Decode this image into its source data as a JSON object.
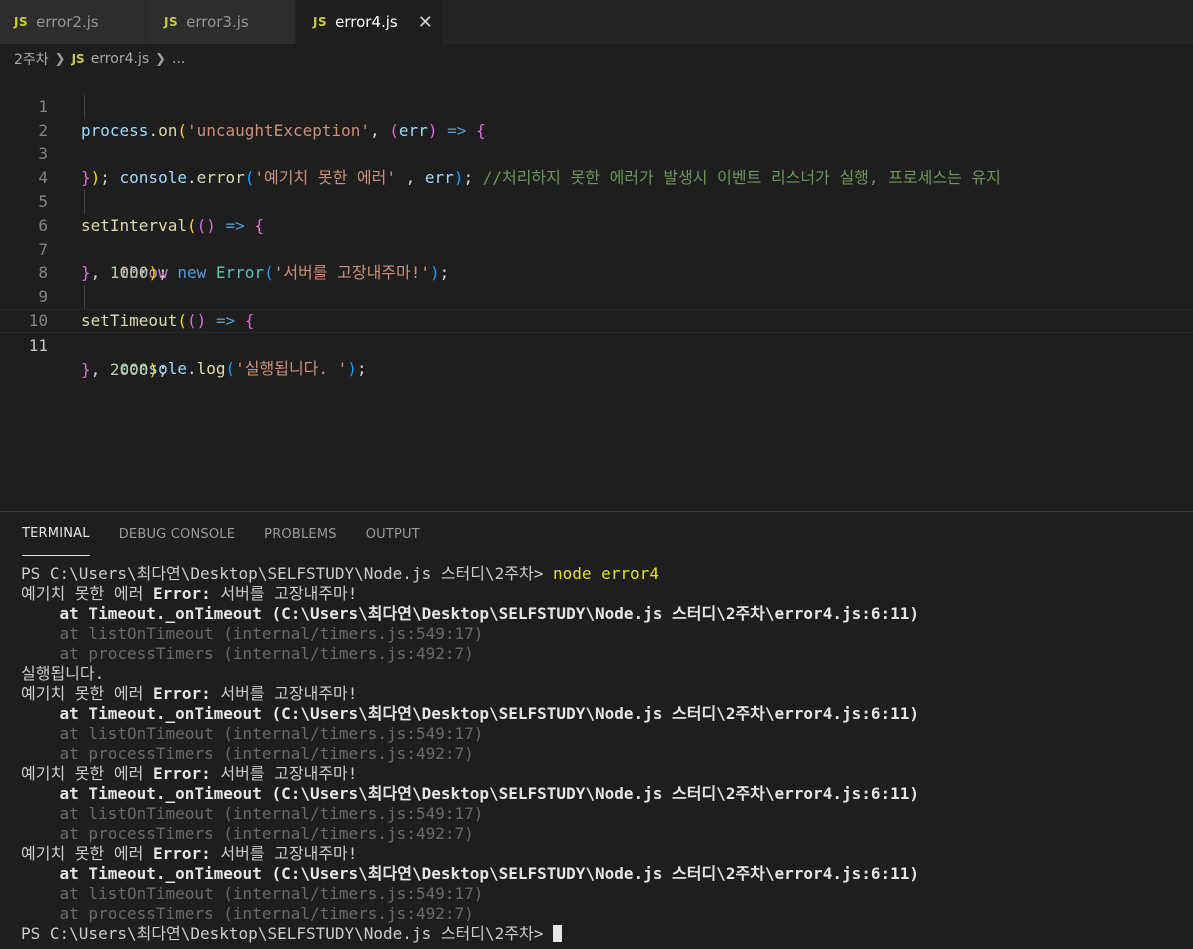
{
  "tabs": [
    {
      "icon": "JS",
      "label": "error2.js"
    },
    {
      "icon": "JS",
      "label": "error3.js"
    },
    {
      "icon": "JS",
      "label": "error4.js",
      "close": "✕"
    }
  ],
  "breadcrumb": {
    "folder": "2주차",
    "file_icon": "JS",
    "file": "error4.js",
    "more": "..."
  },
  "editor": {
    "line_numbers": [
      "1",
      "2",
      "3",
      "4",
      "5",
      "6",
      "7",
      "8",
      "9",
      "10",
      "11"
    ],
    "l1": {
      "process": "process",
      "on": "on",
      "str": "'uncaughtException'",
      "err": "err",
      "arrow": "=>"
    },
    "l2": {
      "console": "console",
      "error": "error",
      "str": "'예기치 못한 에러'",
      "err": "err",
      "comment": "//처리하지 못한 에러가 발생시 이벤트 리스너가 실행, 프로세스는 유지"
    },
    "l5": {
      "fn": "setInterval",
      "arrow": "=>"
    },
    "l6": {
      "throw": "throw",
      "new": "new",
      "cls": "Error",
      "str": "'서버를 고장내주마!'"
    },
    "l7": {
      "num": "1000"
    },
    "l9": {
      "fn": "setTimeout",
      "arrow": "=>"
    },
    "l10": {
      "console": "console",
      "log": "log",
      "str": "'실행됩니다. '"
    },
    "l11": {
      "num": "2000"
    }
  },
  "panel": {
    "tabs": [
      "TERMINAL",
      "DEBUG CONSOLE",
      "PROBLEMS",
      "OUTPUT"
    ],
    "terminal": {
      "prompt": "PS C:\\Users\\최다연\\Desktop\\SELFSTUDY\\Node.js 스터디\\2주차> ",
      "command": "node error4",
      "err_prefix": "예기치 못한 에러 ",
      "err_name": "Error:",
      "err_msg": " 서버를 고장내주마!",
      "stack1": "    at Timeout._onTimeout (C:\\Users\\최다연\\Desktop\\SELFSTUDY\\Node.js 스터디\\2주차\\error4.js:6:11)",
      "stack2": "    at listOnTimeout (internal/timers.js:549:17)",
      "stack3": "    at processTimers (internal/timers.js:492:7)",
      "log": "실행됩니다."
    }
  },
  "colors": {
    "js_icon": "#cbcb41",
    "comment": "#6a9955",
    "string": "#ce9178",
    "keyword": "#569cd6"
  }
}
